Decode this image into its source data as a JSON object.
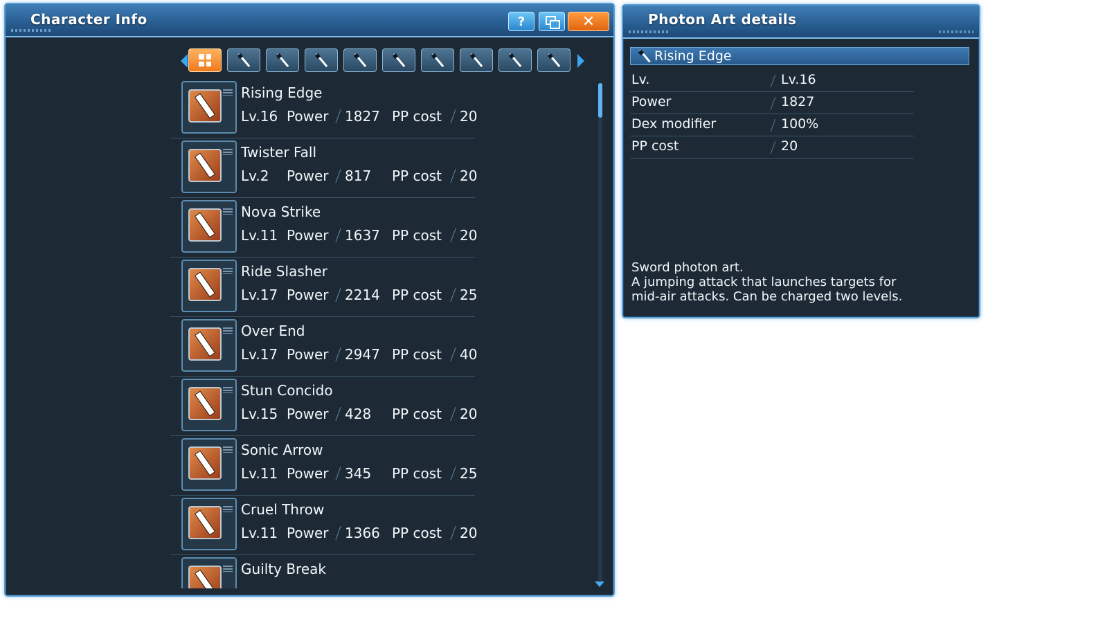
{
  "character_window": {
    "title": "Character Info",
    "buttons": {
      "help": "?",
      "close": "✕"
    },
    "tabs": [
      {
        "id": "all",
        "icon": "grid-icon",
        "active": true
      },
      {
        "id": "sword",
        "icon": "sword-icon"
      },
      {
        "id": "wired-lance",
        "icon": "wired-lance-icon"
      },
      {
        "id": "partisan",
        "icon": "partisan-icon"
      },
      {
        "id": "twin-dagger",
        "icon": "twin-dagger-icon"
      },
      {
        "id": "double-saber",
        "icon": "double-saber-icon"
      },
      {
        "id": "knuckle",
        "icon": "knuckle-icon"
      },
      {
        "id": "katana",
        "icon": "katana-icon"
      },
      {
        "id": "dual-blades",
        "icon": "dual-blades-icon"
      },
      {
        "id": "gunslash",
        "icon": "gunslash-icon"
      }
    ],
    "labels": {
      "power": "Power",
      "pp_cost": "PP cost"
    },
    "photon_arts": [
      {
        "name": "Rising Edge",
        "level": "Lv.16",
        "power": "1827",
        "pp": "20"
      },
      {
        "name": "Twister Fall",
        "level": "Lv.2",
        "power": "817",
        "pp": "20"
      },
      {
        "name": "Nova Strike",
        "level": "Lv.11",
        "power": "1637",
        "pp": "20"
      },
      {
        "name": "Ride Slasher",
        "level": "Lv.17",
        "power": "2214",
        "pp": "25"
      },
      {
        "name": "Over End",
        "level": "Lv.17",
        "power": "2947",
        "pp": "40"
      },
      {
        "name": "Stun Concido",
        "level": "Lv.15",
        "power": "428",
        "pp": "20"
      },
      {
        "name": "Sonic Arrow",
        "level": "Lv.11",
        "power": "345",
        "pp": "25"
      },
      {
        "name": "Cruel Throw",
        "level": "Lv.11",
        "power": "1366",
        "pp": "20"
      },
      {
        "name": "Guilty Break",
        "level": "",
        "power": "",
        "pp": ""
      }
    ]
  },
  "detail_window": {
    "title": "Photon Art details",
    "selected_name": "Rising Edge",
    "rows": [
      {
        "key": "Lv.",
        "value": "Lv.16"
      },
      {
        "key": "Power",
        "value": "1827"
      },
      {
        "key": "Dex modifier",
        "value": "100%"
      },
      {
        "key": "PP cost",
        "value": "20"
      }
    ],
    "description": [
      "Sword photon art.",
      "A jumping attack that launches targets for",
      "mid-air attacks. Can be charged two levels."
    ]
  },
  "colors": {
    "accent_orange": "#f07a1a",
    "accent_blue": "#3aa7ee",
    "panel_bg": "#1d2a35"
  }
}
